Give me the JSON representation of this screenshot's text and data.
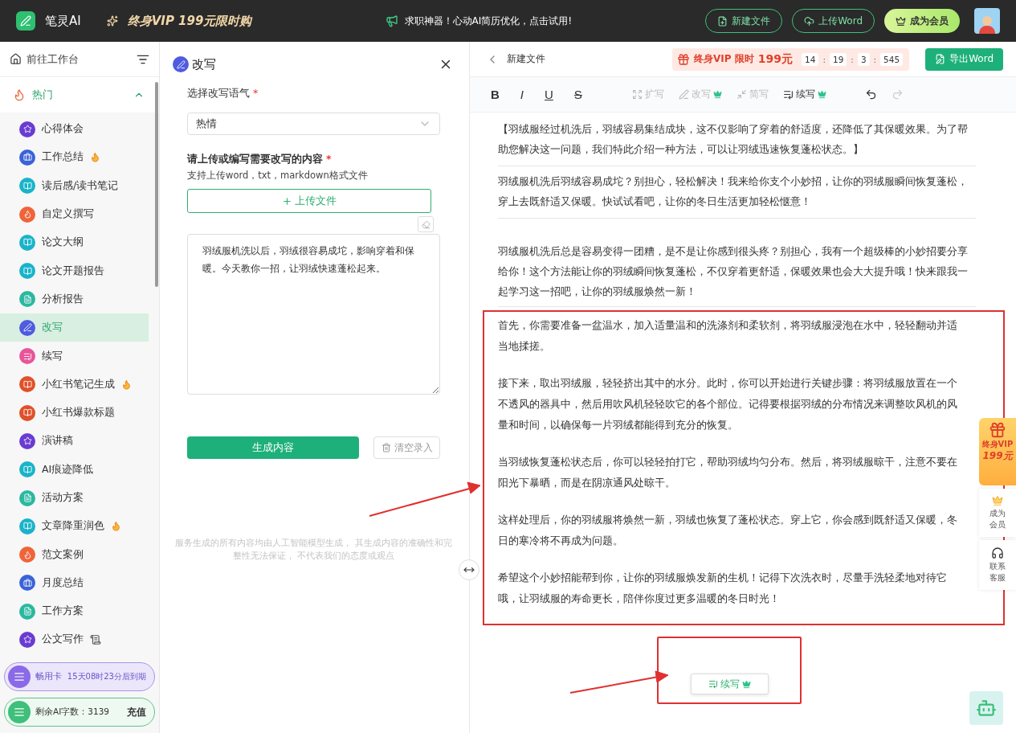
{
  "topbar": {
    "brand": "笔灵AI",
    "promo": "终身VIP 199元限时购",
    "notice": "求职神器！心动AI简历优化，点击试用!",
    "buttons": [
      {
        "label": "新建文件",
        "kind": "new"
      },
      {
        "label": "上传Word",
        "kind": "upload"
      },
      {
        "label": "成为会员",
        "kind": "vip"
      }
    ]
  },
  "sidebar": {
    "home": "前往工作台",
    "group": {
      "label": "热门",
      "expanded": true,
      "items": [
        {
          "label": "心得体会",
          "kind": "star",
          "color": "#6a3bd1",
          "hot": false,
          "attachment": false,
          "selected": false
        },
        {
          "label": "工作总结",
          "kind": "bag",
          "color": "#3a63d8",
          "hot": true,
          "attachment": false,
          "selected": false
        },
        {
          "label": "读后感/读书笔记",
          "kind": "book",
          "color": "#19b4c9",
          "hot": false,
          "attachment": false,
          "selected": false
        },
        {
          "label": "自定义撰写",
          "kind": "flame",
          "color": "#f0643a",
          "hot": false,
          "attachment": false,
          "selected": false
        },
        {
          "label": "论文大纲",
          "kind": "book",
          "color": "#19b4c9",
          "hot": false,
          "attachment": false,
          "selected": false
        },
        {
          "label": "论文开题报告",
          "kind": "book",
          "color": "#19b4c9",
          "hot": false,
          "attachment": false,
          "selected": false
        },
        {
          "label": "分析报告",
          "kind": "doc",
          "color": "#2bb8a0",
          "hot": false,
          "attachment": false,
          "selected": false
        },
        {
          "label": "改写",
          "kind": "pen",
          "color": "#4f5be0",
          "hot": false,
          "attachment": false,
          "selected": true
        },
        {
          "label": "续写",
          "kind": "list",
          "color": "#e8549a",
          "hot": false,
          "attachment": false,
          "selected": false
        },
        {
          "label": "小红书笔记生成",
          "kind": "book",
          "color": "#e0502a",
          "hot": true,
          "attachment": false,
          "selected": false
        },
        {
          "label": "小红书爆款标题",
          "kind": "book",
          "color": "#e0502a",
          "hot": false,
          "attachment": false,
          "selected": false
        },
        {
          "label": "演讲稿",
          "kind": "star",
          "color": "#6a3bd1",
          "hot": false,
          "attachment": false,
          "selected": false
        },
        {
          "label": "AI痕迹降低",
          "kind": "book",
          "color": "#19b4c9",
          "hot": false,
          "attachment": false,
          "selected": false
        },
        {
          "label": "活动方案",
          "kind": "doc",
          "color": "#2bb8a0",
          "hot": false,
          "attachment": false,
          "selected": false
        },
        {
          "label": "文章降重润色",
          "kind": "book",
          "color": "#19b4c9",
          "hot": true,
          "attachment": false,
          "selected": false
        },
        {
          "label": "范文案例",
          "kind": "flame",
          "color": "#f0643a",
          "hot": false,
          "attachment": false,
          "selected": false
        },
        {
          "label": "月度总结",
          "kind": "bag",
          "color": "#3a63d8",
          "hot": false,
          "attachment": false,
          "selected": false
        },
        {
          "label": "工作方案",
          "kind": "doc",
          "color": "#2bb8a0",
          "hot": false,
          "attachment": false,
          "selected": false
        },
        {
          "label": "公文写作",
          "kind": "star",
          "color": "#6a3bd1",
          "hot": false,
          "attachment": true,
          "selected": false
        }
      ]
    },
    "pass": {
      "label": "畅用卡",
      "expiry": "15天08时23分后到期"
    },
    "quota": {
      "label": "剩余AI字数：3139",
      "action": "充值"
    }
  },
  "tool": {
    "title": "改写",
    "tone_label": {
      "text": "选择改写语气",
      "mark": "*"
    },
    "tone": "热情",
    "content_label": {
      "text": "请上传或编写需要改写的内容",
      "mark": "*"
    },
    "formats": "支持上传word，txt，markdown格式文件",
    "upload": "上传文件",
    "text": "羽绒服机洗以后，羽绒很容易成坨，影响穿着和保暖。今天教你一招，让羽绒快速蓬松起来。",
    "generate": "生成内容",
    "clear": "清空录入",
    "disclaimer": "服务生成的所有内容均由人工智能模型生成， 其生成内容的准确性和完整性无法保证， 不代表我们的态度或观点"
  },
  "editor": {
    "back": "新建文件",
    "promo": {
      "label": "终身VIP 限时",
      "price": "199元",
      "timer": [
        {
          "text": "14",
          "kind": "digit"
        },
        {
          "text": ":",
          "kind": "sep"
        },
        {
          "text": "19",
          "kind": "digit"
        },
        {
          "text": ":",
          "kind": "sep"
        },
        {
          "text": "3",
          "kind": "digit"
        },
        {
          "text": ":",
          "kind": "sep"
        },
        {
          "text": "545",
          "kind": "digit"
        }
      ]
    },
    "export": "导出Word",
    "format": [
      {
        "label": "B",
        "kind": "bold"
      },
      {
        "label": "I",
        "kind": "italic"
      },
      {
        "label": "U",
        "kind": "underline"
      },
      {
        "label": "S",
        "kind": "strike"
      }
    ],
    "tools": [
      {
        "label": "扩写",
        "kind": "expand",
        "disabled": true,
        "premium": false
      },
      {
        "label": "改写",
        "kind": "rewrite",
        "disabled": true,
        "premium": true
      },
      {
        "label": "简写",
        "kind": "shorten",
        "disabled": true,
        "premium": false
      },
      {
        "label": "续写",
        "kind": "continue",
        "disabled": false,
        "premium": true
      }
    ],
    "history": [
      {
        "kind": "undo",
        "disabled": false
      },
      {
        "kind": "redo",
        "disabled": true
      }
    ],
    "blocks": [
      {
        "kind": "plain",
        "text": "【羽绒服经过机洗后，羽绒容易集结成块，这不仅影响了穿着的舒适度，还降低了其保暖效果。为了帮助您解决这一问题，我们特此介绍一种方法，可以让羽绒迅速恢复蓬松状态。】"
      },
      {
        "kind": "plain",
        "text": "羽绒服机洗后羽绒容易成坨？别担心，轻松解决！我来给你支个小妙招，让你的羽绒服瞬间恢复蓬松，穿上去既舒适又保暖。快试试看吧，让你的冬日生活更加轻松惬意！"
      },
      {
        "kind": "spaced",
        "text": "羽绒服机洗后总是容易变得一团糟，是不是让你感到很头疼？别担心，我有一个超级棒的小妙招要分享给你！这个方法能让你的羽绒瞬间恢复蓬松，不仅穿着更舒适，保暖效果也会大大提升哦！快来跟我一起学习这一招吧，让你的羽绒服焕然一新！"
      }
    ],
    "highlighted": [
      "首先，你需要准备一盆温水，加入适量温和的洗涤剂和柔软剂，将羽绒服浸泡在水中，轻轻翻动并适当地揉搓。",
      "接下来，取出羽绒服，轻轻挤出其中的水分。此时，你可以开始进行关键步骤：将羽绒服放置在一个不透风的器具中，然后用吹风机轻轻吹它的各个部位。记得要根据羽绒的分布情况来调整吹风机的风量和时间，以确保每一片羽绒都能得到充分的恢复。",
      "当羽绒恢复蓬松状态后，你可以轻轻拍打它，帮助羽绒均匀分布。然后，将羽绒服晾干，注意不要在阳光下暴晒，而是在阴凉通风处晾干。",
      "这样处理后，你的羽绒服将焕然一新，羽绒也恢复了蓬松状态。穿上它，你会感到既舒适又保暖，冬日的寒冷将不再成为问题。",
      "希望这个小妙招能帮到你，让你的羽绒服焕发新的生机！记得下次洗衣时，尽量手洗轻柔地对待它哦，让羽绒服的寿命更长，陪伴你度过更多温暖的冬日时光！"
    ],
    "continue_button": "续写"
  },
  "float": {
    "vip": "终身VIP",
    "price": "199元",
    "member": "成为会员",
    "service": "联系客服"
  }
}
